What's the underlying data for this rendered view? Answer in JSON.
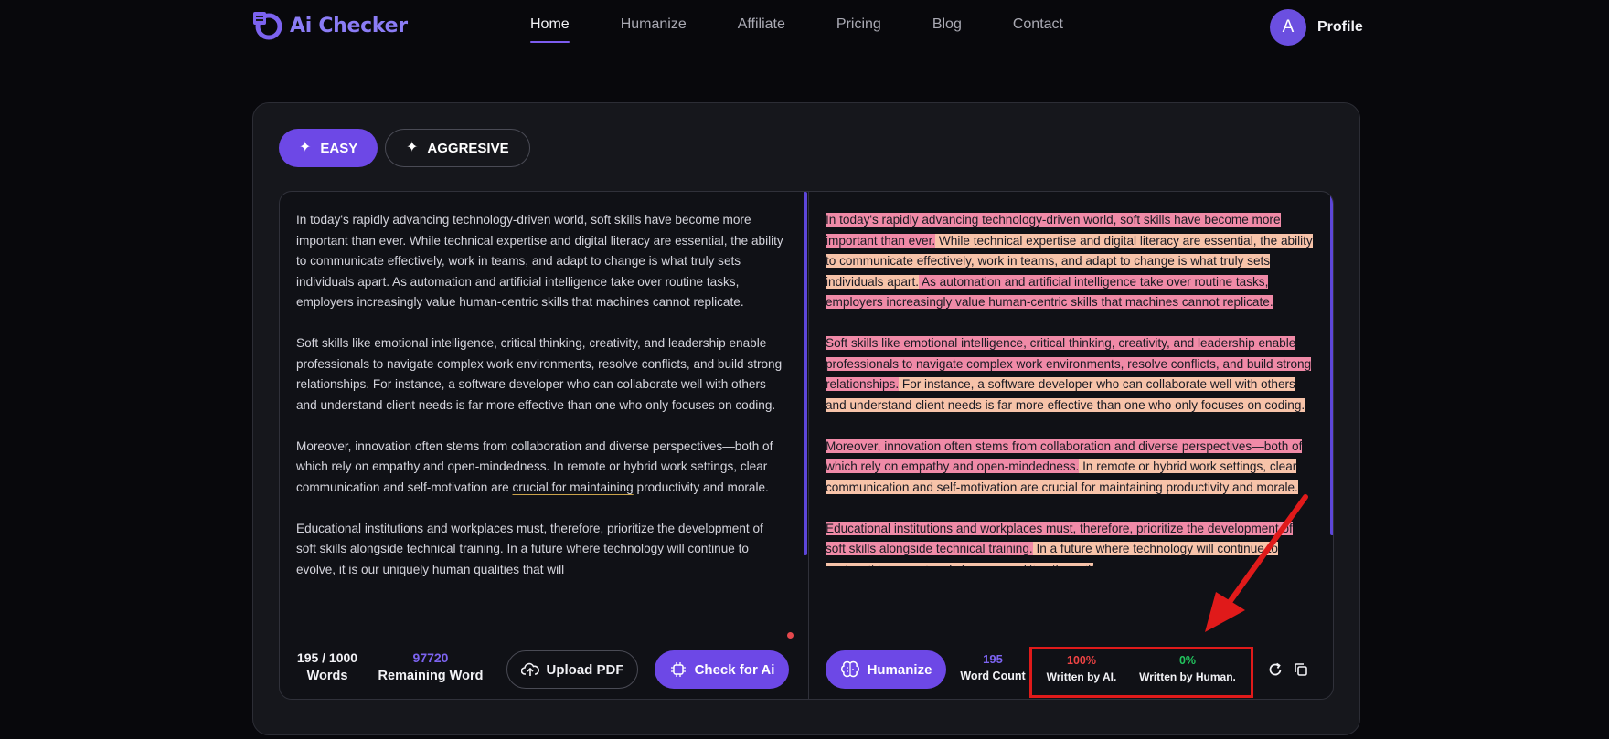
{
  "brand": {
    "name": "Ai Checker",
    "accent": "#6d48e6"
  },
  "nav": {
    "links": [
      "Home",
      "Humanize",
      "Affiliate",
      "Pricing",
      "Blog",
      "Contact"
    ],
    "active": "Home"
  },
  "profile": {
    "initial": "A",
    "label": "Profile"
  },
  "modes": {
    "easy": "EASY",
    "aggressive": "AGGRESIVE",
    "selected": "EASY"
  },
  "input": {
    "paragraphs": [
      {
        "pre": "In today's rapidly ",
        "u": "advancing",
        "post": " technology-driven world, soft skills have become more important than ever. While technical expertise and digital literacy are essential, the ability to communicate effectively, work in teams, and adapt to change is what truly sets individuals apart. As automation and artificial intelligence take over routine tasks, employers increasingly value human-centric skills that machines cannot replicate."
      },
      {
        "pre": "Soft skills like emotional intelligence, critical thinking, creativity, and leadership enable professionals to navigate complex work environments, resolve conflicts, and build strong relationships. For instance, a software developer who can collaborate well with others and understand client needs is far more effective than one who only focuses on coding.",
        "u": "",
        "post": ""
      },
      {
        "pre": "Moreover, innovation often stems from collaboration and diverse perspectives—both of which rely on empathy and open-mindedness. In remote or hybrid work settings, clear communication and self-motivation are ",
        "u": "crucial for maintaining",
        "post": " productivity and morale."
      },
      {
        "pre": "Educational institutions and workplaces must, therefore, prioritize the development of soft skills alongside technical training. In a future where technology will continue to evolve, it is our uniquely human qualities that will",
        "u": "",
        "post": ""
      }
    ]
  },
  "output": {
    "paragraphs": [
      [
        {
          "t": "In today's rapidly advancing technology-driven world, soft skills have become more important than ever.",
          "c": "pink"
        },
        {
          "t": " While technical expertise and digital literacy are essential, the ability to communicate effectively, work in teams, and adapt to change is what truly sets individuals apart.",
          "c": "peach"
        },
        {
          "t": " As automation and artificial intelligence take over routine tasks, employers increasingly value human-centric skills that machines cannot replicate.",
          "c": "pink"
        }
      ],
      [
        {
          "t": "Soft skills like emotional intelligence, critical thinking, creativity, and leadership enable professionals to navigate complex work environments, resolve conflicts, and build strong relationships.",
          "c": "pink"
        },
        {
          "t": " For instance, a software developer who can collaborate well with others and understand client needs is far more effective than one who only focuses on coding.",
          "c": "peach"
        }
      ],
      [
        {
          "t": "Moreover, innovation often stems from collaboration and diverse perspectives—both of which rely on empathy and open-mindedness.",
          "c": "pink"
        },
        {
          "t": " In remote or hybrid work settings, clear communication and self-motivation are crucial for maintaining productivity and morale.",
          "c": "peach"
        }
      ],
      [
        {
          "t": "Educational institutions and workplaces must, therefore, prioritize the development of soft skills alongside technical training.",
          "c": "pink"
        },
        {
          "t": " In a future where technology will continue to evolve, it is our uniquely human qualities that will",
          "c": "peach"
        }
      ]
    ]
  },
  "left_footer": {
    "word_count": "195 / 1000",
    "words_label": "Words",
    "remaining_value": "97720",
    "remaining_label": "Remaining Word",
    "upload_label": "Upload PDF",
    "check_label": "Check for Ai"
  },
  "right_footer": {
    "humanize_label": "Humanize",
    "word_count": "195",
    "word_count_label": "Word Count",
    "ai_percent": "100%",
    "ai_label": "Written by AI.",
    "human_percent": "0%",
    "human_label": "Written by Human."
  },
  "icons": [
    "sparkle-icon",
    "upload-cloud-icon",
    "ai-chip-icon",
    "brain-icon",
    "refresh-icon",
    "copy-icon"
  ]
}
